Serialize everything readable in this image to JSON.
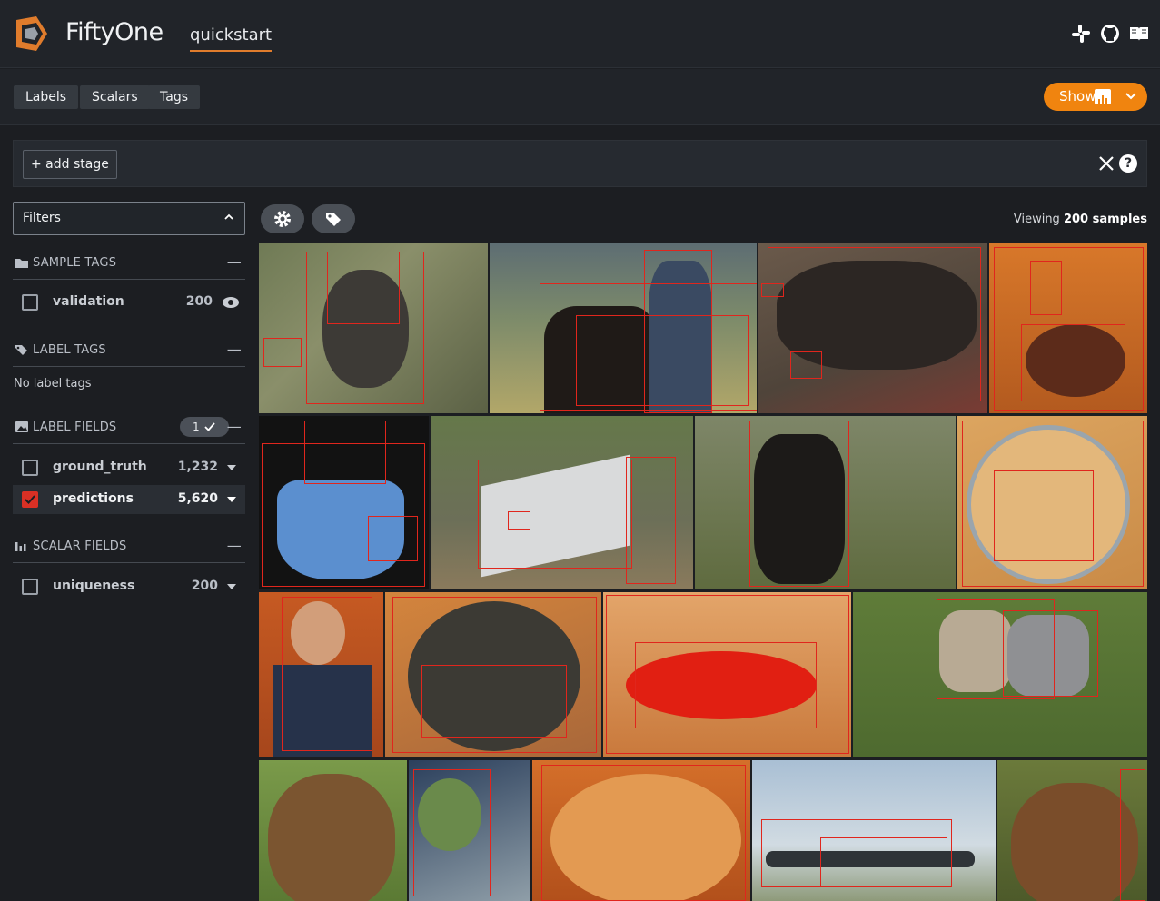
{
  "header": {
    "app_name": "FiftyOne",
    "dataset": "quickstart",
    "icons": [
      "slack-icon",
      "github-icon",
      "docs-book-icon"
    ]
  },
  "tabs": [
    {
      "label": "Labels"
    },
    {
      "label": "Scalars"
    },
    {
      "label": "Tags"
    }
  ],
  "show_button": {
    "label": "Show"
  },
  "stage_bar": {
    "add_stage_label": "+ add stage",
    "help_label": "?"
  },
  "sidebar": {
    "filters_label": "Filters",
    "sample_tags": {
      "title": "SAMPLE TAGS",
      "items": [
        {
          "label": "validation",
          "count": "200"
        }
      ]
    },
    "label_tags": {
      "title": "LABEL TAGS",
      "empty_text": "No label tags"
    },
    "label_fields": {
      "title": "LABEL FIELDS",
      "badge": "1",
      "items": [
        {
          "label": "ground_truth",
          "count": "1,232",
          "checked": false
        },
        {
          "label": "predictions",
          "count": "5,620",
          "checked": true
        }
      ]
    },
    "scalar_fields": {
      "title": "SCALAR FIELDS",
      "items": [
        {
          "label": "uniqueness",
          "count": "200"
        }
      ]
    }
  },
  "viewing": {
    "prefix": "Viewing",
    "count": "200 samples"
  },
  "colors": {
    "accent": "#f0840f",
    "box": "#e0261d",
    "bg": "#1c1e22"
  }
}
